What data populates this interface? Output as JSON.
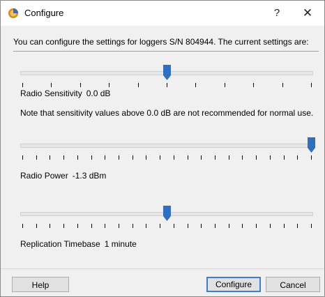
{
  "window": {
    "title": "Configure",
    "help_glyph": "?",
    "close_glyph": "✕",
    "app_icon": "configure-app-icon"
  },
  "intro_text": "You can configure the settings for loggers S/N 804944. The current settings are:",
  "sliders": [
    {
      "name": "Radio Sensitivity",
      "value_text": "0.0 dB",
      "position_fraction": 0.5,
      "tick_count": 11
    },
    {
      "name": "Radio Power",
      "value_text": "-1.3 dBm",
      "position_fraction": 1.0,
      "tick_count": 22
    },
    {
      "name": "Replication Timebase",
      "value_text": "1 minute",
      "position_fraction": 0.5,
      "tick_count": 22
    }
  ],
  "note_text": "Note that sensitivity values above 0.0 dB are not recommended for normal use.",
  "buttons": {
    "help": "Help",
    "configure": "Configure",
    "cancel": "Cancel"
  },
  "colors": {
    "thumb": "#2e6fc2",
    "default_button_border": "#3c7fd0"
  }
}
